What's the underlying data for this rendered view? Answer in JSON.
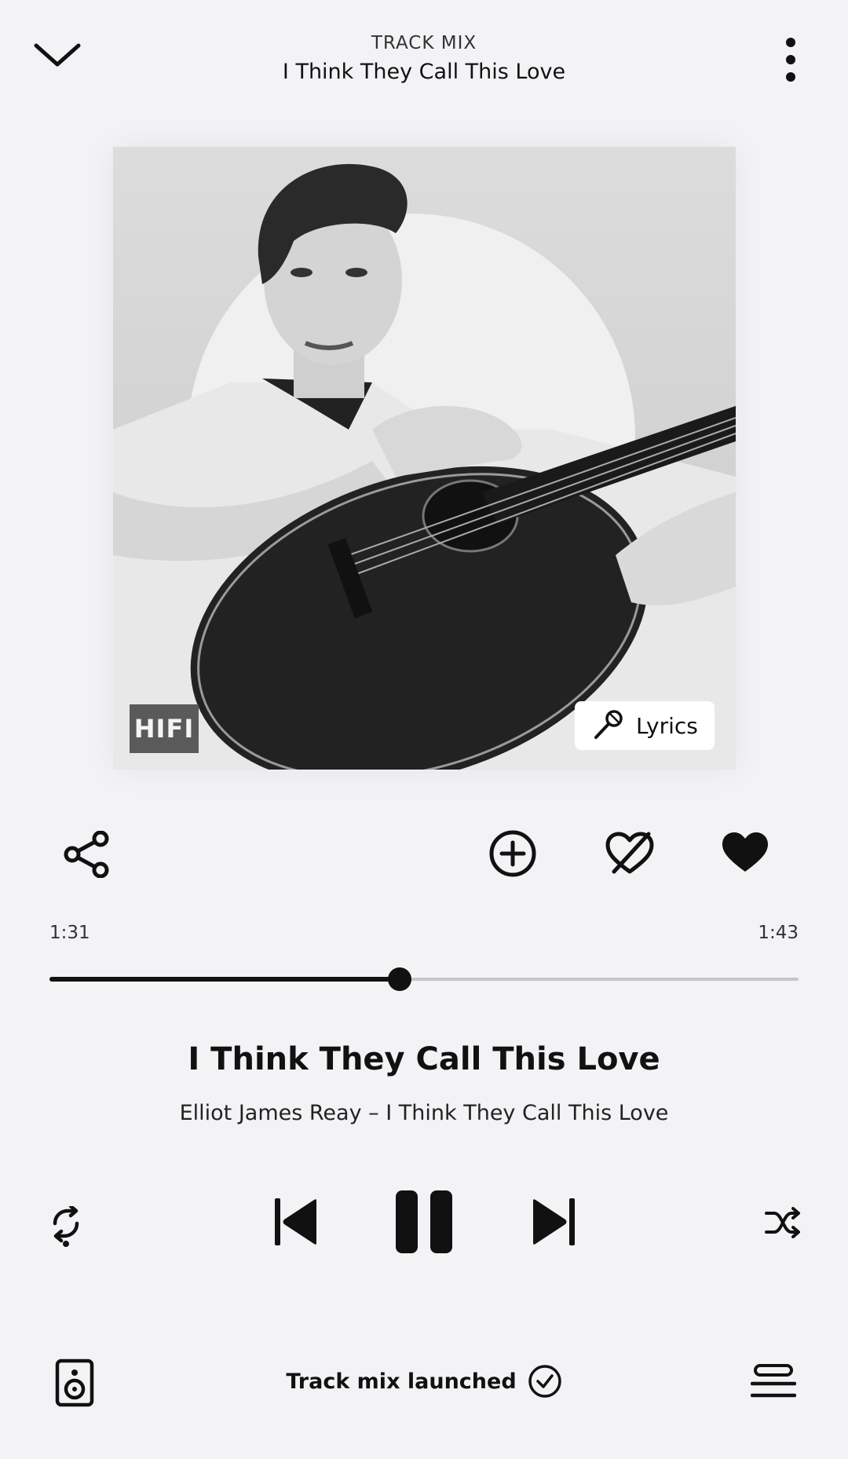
{
  "header": {
    "kicker": "TRACK MIX",
    "title": "I Think They Call This Love"
  },
  "artwork": {
    "badge": "HIFI",
    "lyrics_label": "Lyrics"
  },
  "playback": {
    "elapsed": "1:31",
    "total": "1:43",
    "progress": 0.468
  },
  "track": {
    "title": "I Think They Call This Love",
    "subtitle": "Elliot James Reay – I Think They Call This Love"
  },
  "footer": {
    "status": "Track mix launched"
  },
  "icons": {
    "collapse": "chevron-down-icon",
    "menu": "more-vertical-icon",
    "share": "share-icon",
    "add": "add-circle-icon",
    "dislike": "heart-off-icon",
    "like": "heart-filled-icon",
    "repeat": "repeat-icon",
    "previous": "skip-previous-icon",
    "pause": "pause-icon",
    "next": "skip-next-icon",
    "shuffle": "shuffle-icon",
    "speaker": "speaker-icon",
    "queue": "queue-icon",
    "check": "check-circle-icon",
    "microphone": "microphone-icon"
  },
  "colors": {
    "background": "#f3f2f5",
    "accent": "#111111",
    "track": "#c6c6c6"
  }
}
